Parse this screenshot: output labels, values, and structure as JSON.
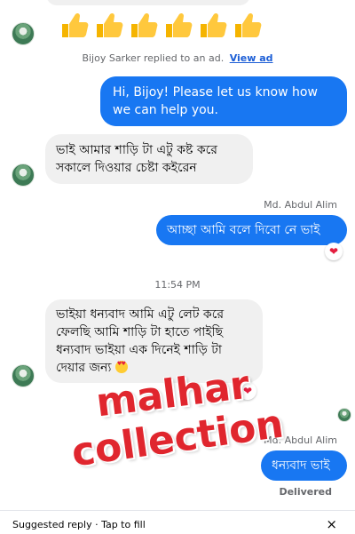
{
  "messages": {
    "system_note": "Bijoy Sarker replied to an ad.",
    "system_link": "View ad",
    "page_greeting": "Hi, Bijoy! Please let us know how we can help you.",
    "customer_msg_1_line1": "ভাই আমার শাড়ি টা এটু কষ্ট করে",
    "customer_msg_1_line2": "সকালে দিওয়ার চেষ্টা কইরেন",
    "sender_name_1": "Md. Abdul Alim",
    "page_reply_1": "আচ্ছা আমি বলে দিবো নে ভাই",
    "timestamp": "11:54 PM",
    "customer_msg_2_line1": "ভাইয়া ধন্যবাদ  আমি এটু লেট করে",
    "customer_msg_2_line2": "ফেলছি আমি শাড়ি টা হাতে পাইছি",
    "customer_msg_2_line3": "ধন্যবাদ ভাইয়া এক দিনেই শাড়ি টা",
    "customer_msg_2_line4": "দেয়ার জন্য",
    "sender_name_2": "Md. Abdul Alim",
    "page_reply_2": "ধন্যবাদ ভাই",
    "status": "Delivered"
  },
  "reactions": {
    "reply_1": "❤",
    "customer_msg_2": "❤"
  },
  "watermark": {
    "line1": "malhar",
    "line2": "collection",
    "color": "#e0262e"
  },
  "suggestion_bar": {
    "text": "Suggested reply · Tap to fill",
    "close": "×"
  },
  "colors": {
    "outgoing_bubble": "#1877f2",
    "incoming_bubble": "#f0f0f0",
    "link": "#1c5ed6"
  },
  "icons": {
    "thumbs": "thumbs-up-icon",
    "reaction": "heart-icon",
    "close": "close-icon"
  }
}
